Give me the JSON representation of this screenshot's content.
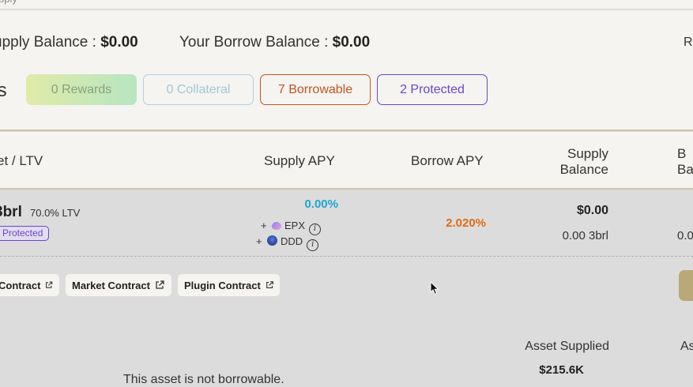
{
  "top": {
    "cut_text": "pply"
  },
  "balances": {
    "supply_label": "upply Balance :",
    "supply_value": "$0.00",
    "borrow_label": "Your Borrow Balance :",
    "borrow_value": "$0.00",
    "right_cut": "R"
  },
  "assets_heading": "ts",
  "filters": {
    "rewards": "0 Rewards",
    "collateral": "0 Collateral",
    "borrowable": "7 Borrowable",
    "protected": "2 Protected"
  },
  "table": {
    "headers": {
      "asset": "et / LTV",
      "supply_apy": "Supply APY",
      "borrow_apy": "Borrow APY",
      "supply_balance_l1": "Supply",
      "supply_balance_l2": "Balance",
      "borrow_balance_l1": "B",
      "borrow_balance_l2": "Ba"
    },
    "row": {
      "asset": "3brl",
      "ltv": "70.0% LTV",
      "badge": "Protected",
      "supply_apy": "0.00%",
      "rewards": [
        {
          "plus": "+",
          "token": "EPX",
          "icon": "epx-token-icon"
        },
        {
          "plus": "+",
          "token": "DDD",
          "icon": "ddd-token-icon"
        }
      ],
      "borrow_apy": "2.020%",
      "supply_balance_usd": "$0.00",
      "supply_balance_token": "0.00 3brl",
      "borrow_balance_token": "0.0"
    }
  },
  "links": {
    "contract": "Contract",
    "market": "Market Contract",
    "plugin": "Plugin Contract"
  },
  "details": {
    "not_borrowable": "This asset is not borrowable.",
    "asset_supplied_label": "Asset Supplied",
    "asset_supplied_value": "$215.6K",
    "right_cut": "As"
  },
  "colors": {
    "cyan": "#1da7d1",
    "orange": "#e06b16",
    "purple": "#6b47c7",
    "gold": "#b9a878"
  }
}
